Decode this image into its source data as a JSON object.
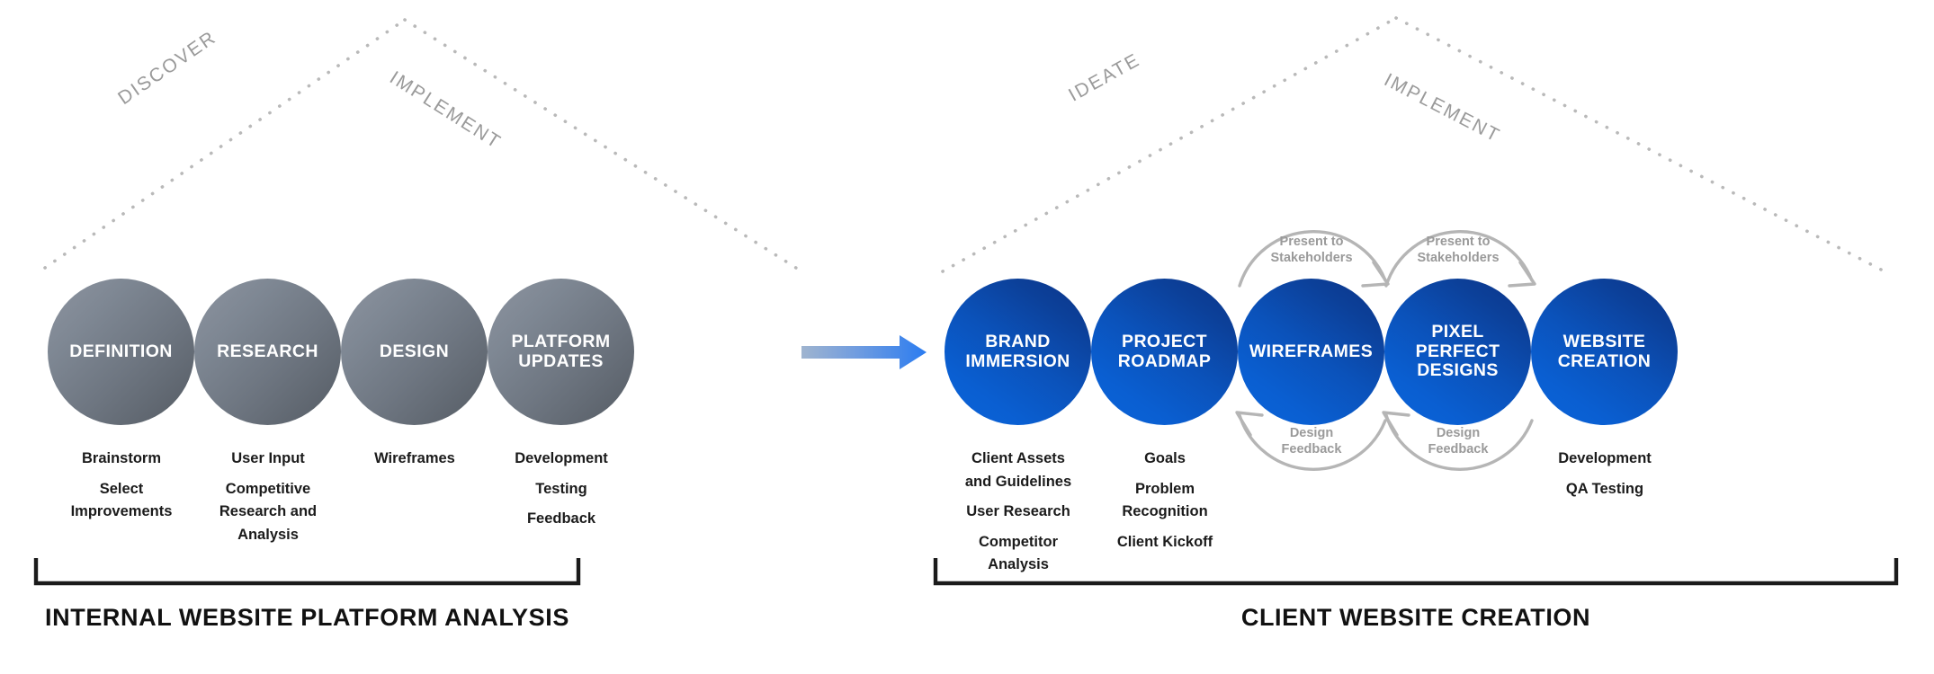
{
  "diagram": {
    "title_internal": "INTERNAL WEBSITE PLATFORM ANALYSIS",
    "title_client": "CLIENT WEBSITE CREATION",
    "phases": [
      {
        "label": "DISCOVER"
      },
      {
        "label": "IMPLEMENT"
      },
      {
        "label": "IDEATE"
      },
      {
        "label": "IMPLEMENT"
      }
    ],
    "internal_nodes": [
      {
        "label": "DEFINITION",
        "sub": [
          "Brainstorm",
          "Select\nImprovements"
        ]
      },
      {
        "label": "RESEARCH",
        "sub": [
          "User Input",
          "Competitive\nResearch and\nAnalysis"
        ]
      },
      {
        "label": "DESIGN",
        "sub": [
          "Wireframes"
        ]
      },
      {
        "label": "PLATFORM\nUPDATES",
        "sub": [
          "Development",
          "Testing",
          "Feedback"
        ]
      }
    ],
    "client_nodes": [
      {
        "label": "BRAND\nIMMERSION",
        "sub": [
          "Client Assets\nand Guidelines",
          "User Research",
          "Competitor\nAnalysis"
        ]
      },
      {
        "label": "PROJECT\nROADMAP",
        "sub": [
          "Goals",
          "Problem\nRecognition",
          "Client Kickoff"
        ]
      },
      {
        "label": "WIREFRAMES",
        "sub": []
      },
      {
        "label": "PIXEL\nPERFECT\nDESIGNS",
        "sub": []
      },
      {
        "label": "WEBSITE\nCREATION",
        "sub": [
          "Development",
          "QA Testing"
        ]
      }
    ],
    "loops": [
      {
        "label": "Present to\nStakeholders"
      },
      {
        "label": "Design\nFeedback"
      },
      {
        "label": "Present to\nStakeholders"
      },
      {
        "label": "Design\nFeedback"
      }
    ],
    "colors": {
      "gray_light": "#8d94a0",
      "gray_dark": "#565c65",
      "blue_light": "#0a63d8",
      "blue_dark": "#0c3488",
      "arrow_gray": "#a8b0b8",
      "arrow_blue": "#2b7cf0",
      "dotted": "#b9b9b9",
      "loop_arc": "#b5b5b5",
      "text_dark": "#1b1b1b"
    }
  }
}
